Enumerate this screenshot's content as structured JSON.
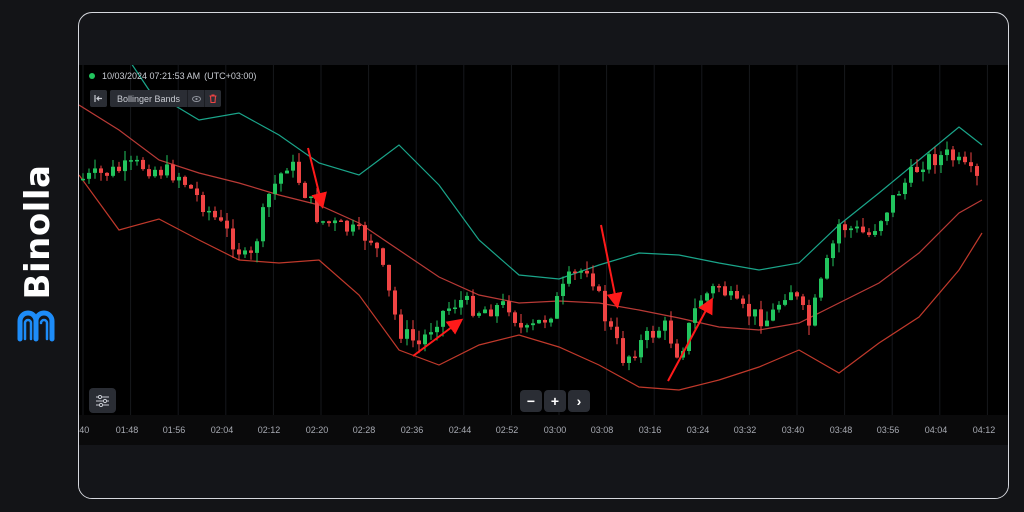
{
  "brand": {
    "name": "Binolla",
    "logo_icon": "binolla-logo-icon",
    "logo_color": "#1d8cf8"
  },
  "chart": {
    "timestamp": "10/03/2024 07:21:53 AM",
    "timezone": "(UTC+03:00)",
    "status_color": "#22c55e",
    "indicator": {
      "name": "Bollinger Bands",
      "collapse_icon": "collapse-left-icon",
      "visibility_icon": "eye-icon",
      "delete_icon": "trash-icon"
    },
    "settings_icon": "sliders-icon",
    "zoom": {
      "zoom_out_label": "−",
      "zoom_in_label": "+",
      "next_label": "›"
    },
    "time_axis_labels": [
      ":40",
      "01:48",
      "01:56",
      "02:04",
      "02:12",
      "02:20",
      "02:28",
      "02:36",
      "02:44",
      "02:52",
      "03:00",
      "03:08",
      "03:16",
      "03:24",
      "03:32",
      "03:40",
      "03:48",
      "03:56",
      "04:04",
      "04:12"
    ],
    "colors": {
      "bull": "#22c55e",
      "bear": "#ef4444",
      "upper_band": "#1aa58a",
      "middle_band": "#b93a36",
      "lower_band": "#c0392b",
      "arrows": "#ff1a1a"
    },
    "annotations": [
      "arrow-down-1",
      "arrow-up-1",
      "arrow-down-2",
      "arrow-up-2"
    ]
  }
}
